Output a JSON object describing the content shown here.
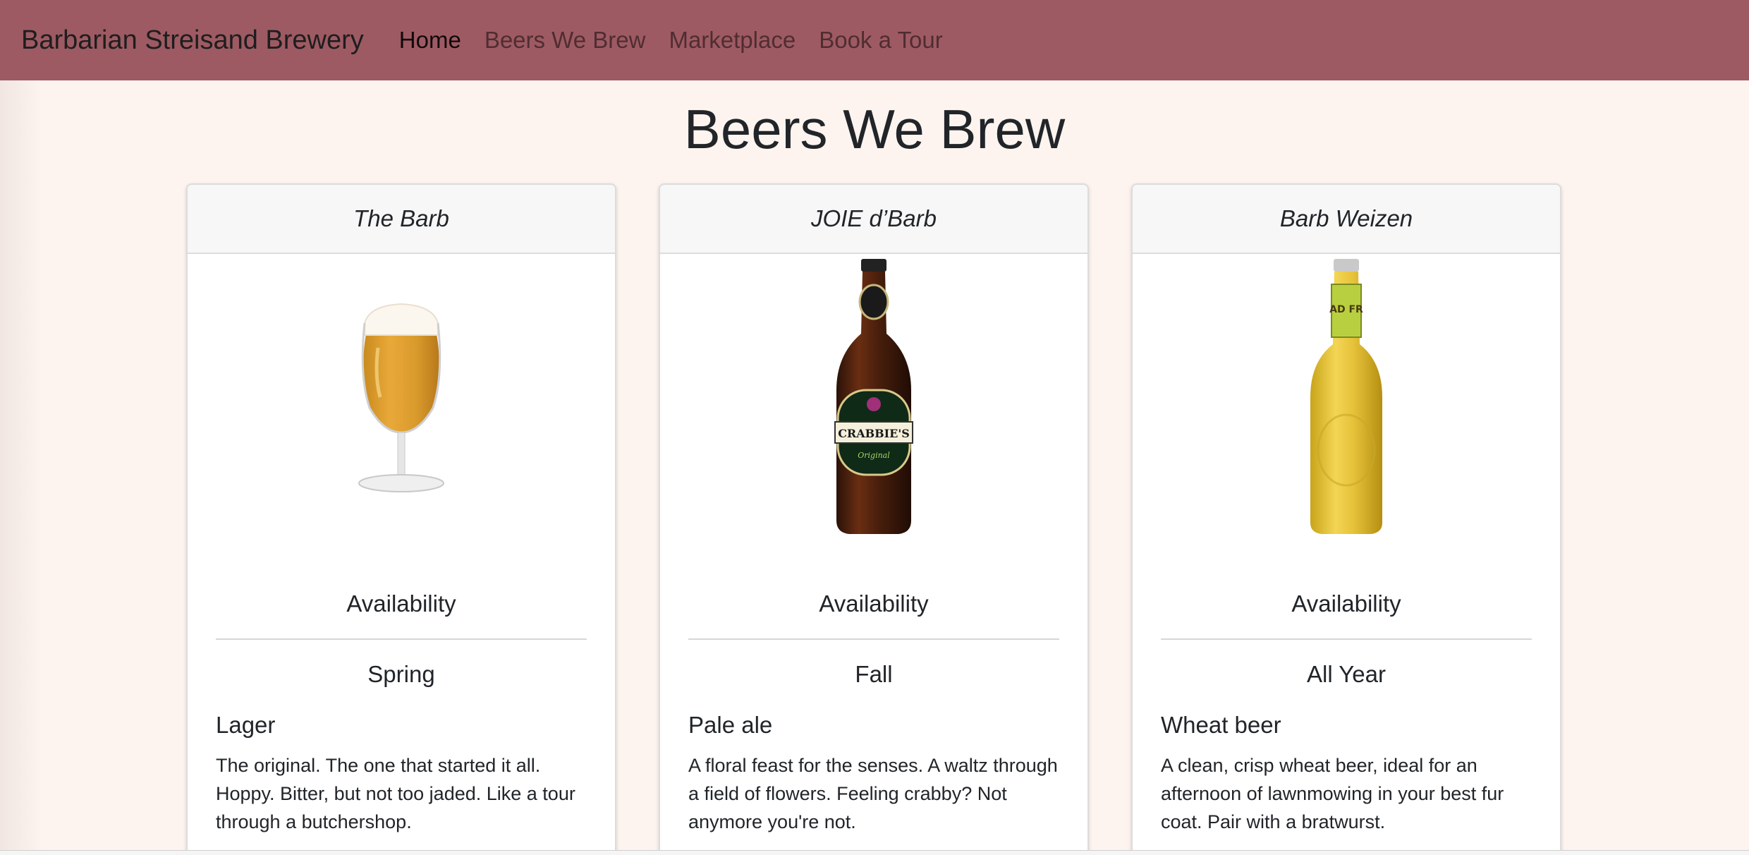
{
  "navbar": {
    "brand": "Barbarian Streisand Brewery",
    "links": [
      {
        "label": "Home",
        "active": true
      },
      {
        "label": "Beers We Brew",
        "active": false
      },
      {
        "label": "Marketplace",
        "active": false
      },
      {
        "label": "Book a Tour",
        "active": false
      }
    ],
    "background": "#9e5a63"
  },
  "page": {
    "title": "Beers We Brew"
  },
  "beers": [
    {
      "name": "The Barb",
      "image": "beer-glass-icon",
      "availability_label": "Availability",
      "season": "Spring",
      "style": "Lager",
      "description": "The original. The one that started it all. Hoppy. Bitter, but not too jaded. Like a tour through a butchershop."
    },
    {
      "name": "JOIE d’Barb",
      "image": "brown-bottle-icon",
      "availability_label": "Availability",
      "season": "Fall",
      "style": "Pale ale",
      "description": "A floral feast for the senses. A waltz through a field of flowers. Feeling crabby? Not anymore you're not."
    },
    {
      "name": "Barb Weizen",
      "image": "yellow-bottle-icon",
      "availability_label": "Availability",
      "season": "All Year",
      "style": "Wheat beer",
      "description": "A clean, crisp wheat beer, ideal for an afternoon of lawnmowing in your best fur coat. Pair with a bratwurst."
    }
  ]
}
